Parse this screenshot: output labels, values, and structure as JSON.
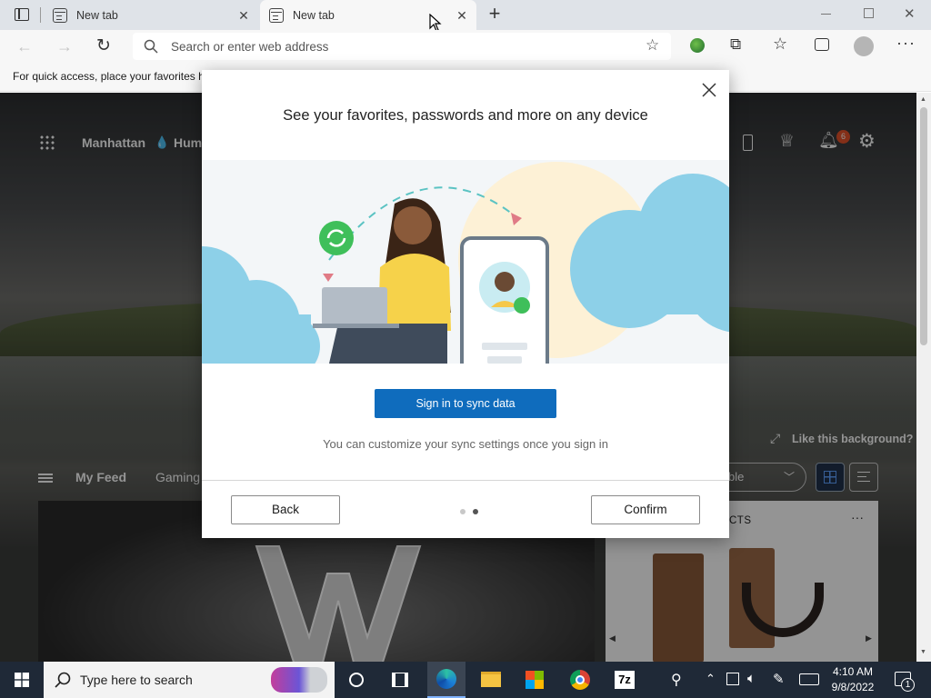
{
  "browser": {
    "tabs": [
      {
        "label": "New tab"
      },
      {
        "label": "New tab"
      }
    ],
    "address_placeholder": "Search or enter web address",
    "favorites_bar_text": "For quick access, place your favorites h"
  },
  "ntp": {
    "location": "Manhattan",
    "weather_label": "Hum",
    "notification_count": "6",
    "like_background": "Like this background?",
    "feed_tabs": [
      "My Feed",
      "Gaming"
    ],
    "dropdown_fragment": "ble",
    "card_header_fragment": "CTS"
  },
  "dialog": {
    "title": "See your favorites, passwords and more on any device",
    "primary_button": "Sign in to sync data",
    "note": "You can customize your sync settings once you sign in",
    "back_button": "Back",
    "confirm_button": "Confirm",
    "pager": {
      "total": 2,
      "current": 2
    }
  },
  "taskbar": {
    "search_placeholder": "Type here to search",
    "time": "4:10 AM",
    "date": "9/8/2022",
    "notification_badge": "1"
  },
  "colors": {
    "accent": "#0f6cbd",
    "taskbar": "#1f2937",
    "notification": "#e3522a"
  }
}
